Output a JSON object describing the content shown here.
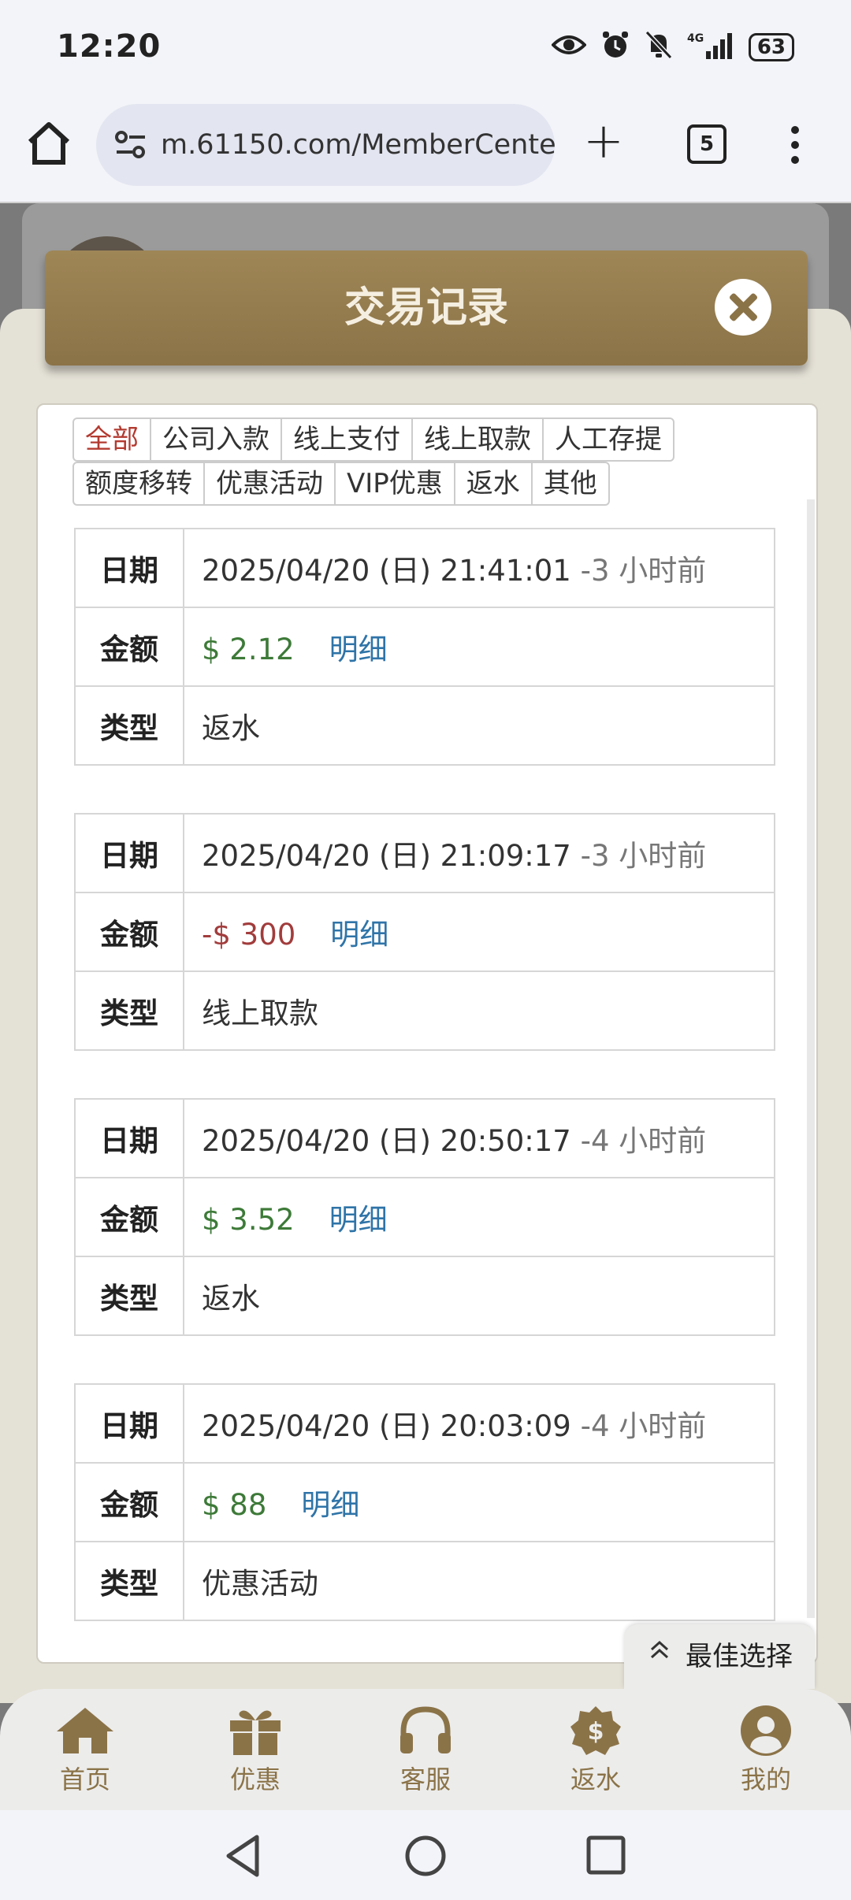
{
  "status_bar": {
    "time": "12:20",
    "network": "4G",
    "battery": "63"
  },
  "browser": {
    "url": "m.61150.com/MemberCente",
    "tab_count": "5"
  },
  "modal": {
    "title": "交易记录",
    "filters_row1": [
      "全部",
      "公司入款",
      "线上支付",
      "线上取款",
      "人工存提"
    ],
    "filters_row2": [
      "额度移转",
      "优惠活动",
      "VIP优惠",
      "返水",
      "其他"
    ],
    "active_filter": "全部",
    "labels": {
      "date": "日期",
      "amount": "金额",
      "type": "类型",
      "detail": "明细"
    },
    "records": [
      {
        "date": "2025/04/20 (日) 21:41:01",
        "ago": "-3 小时前",
        "amount": "$ 2.12",
        "type": "返水"
      },
      {
        "date": "2025/04/20 (日) 21:09:17",
        "ago": "-3 小时前",
        "amount": "-$ 300",
        "type": "线上取款"
      },
      {
        "date": "2025/04/20 (日) 20:50:17",
        "ago": "-4 小时前",
        "amount": "$ 3.52",
        "type": "返水"
      },
      {
        "date": "2025/04/20 (日) 20:03:09",
        "ago": "-4 小时前",
        "amount": "$ 88",
        "type": "优惠活动"
      }
    ]
  },
  "best_choice": "最佳选择",
  "bottom_nav": [
    {
      "label": "首页",
      "icon": "home-icon"
    },
    {
      "label": "优惠",
      "icon": "gift-icon"
    },
    {
      "label": "客服",
      "icon": "headset-icon"
    },
    {
      "label": "返水",
      "icon": "dollar-badge-icon"
    },
    {
      "label": "我的",
      "icon": "user-icon"
    }
  ],
  "colors": {
    "brand": "#8b7348",
    "positive": "#3d7a38",
    "negative": "#a23c3c",
    "link": "#2f74a8",
    "active_tab": "#b33a30"
  }
}
